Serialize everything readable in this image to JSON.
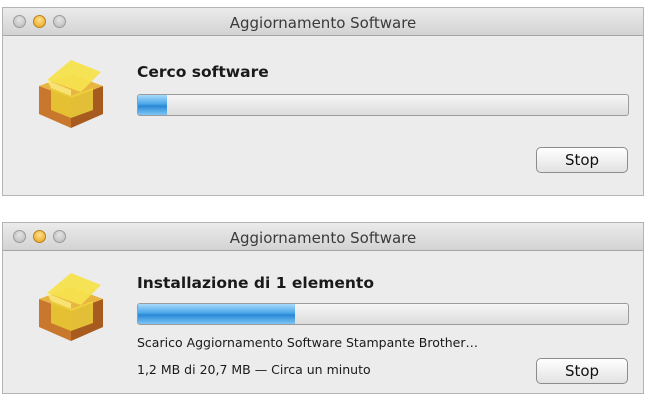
{
  "icons": {
    "window_icon": "package-box-icon"
  },
  "colors": {
    "progress_fill": "#3a96e0",
    "track": "#e2e2e2"
  },
  "window1": {
    "title": "Aggiornamento Software",
    "heading": "Cerco software",
    "progress": 0.06,
    "stop_label": "Stop"
  },
  "window2": {
    "title": "Aggiornamento Software",
    "heading": "Installazione di 1 elemento",
    "progress": 0.32,
    "status_line1": "Scarico Aggiornamento Software Stampante Brother…",
    "status_line2": "1,2 MB di 20,7 MB — Circa un minuto",
    "stop_label": "Stop"
  }
}
